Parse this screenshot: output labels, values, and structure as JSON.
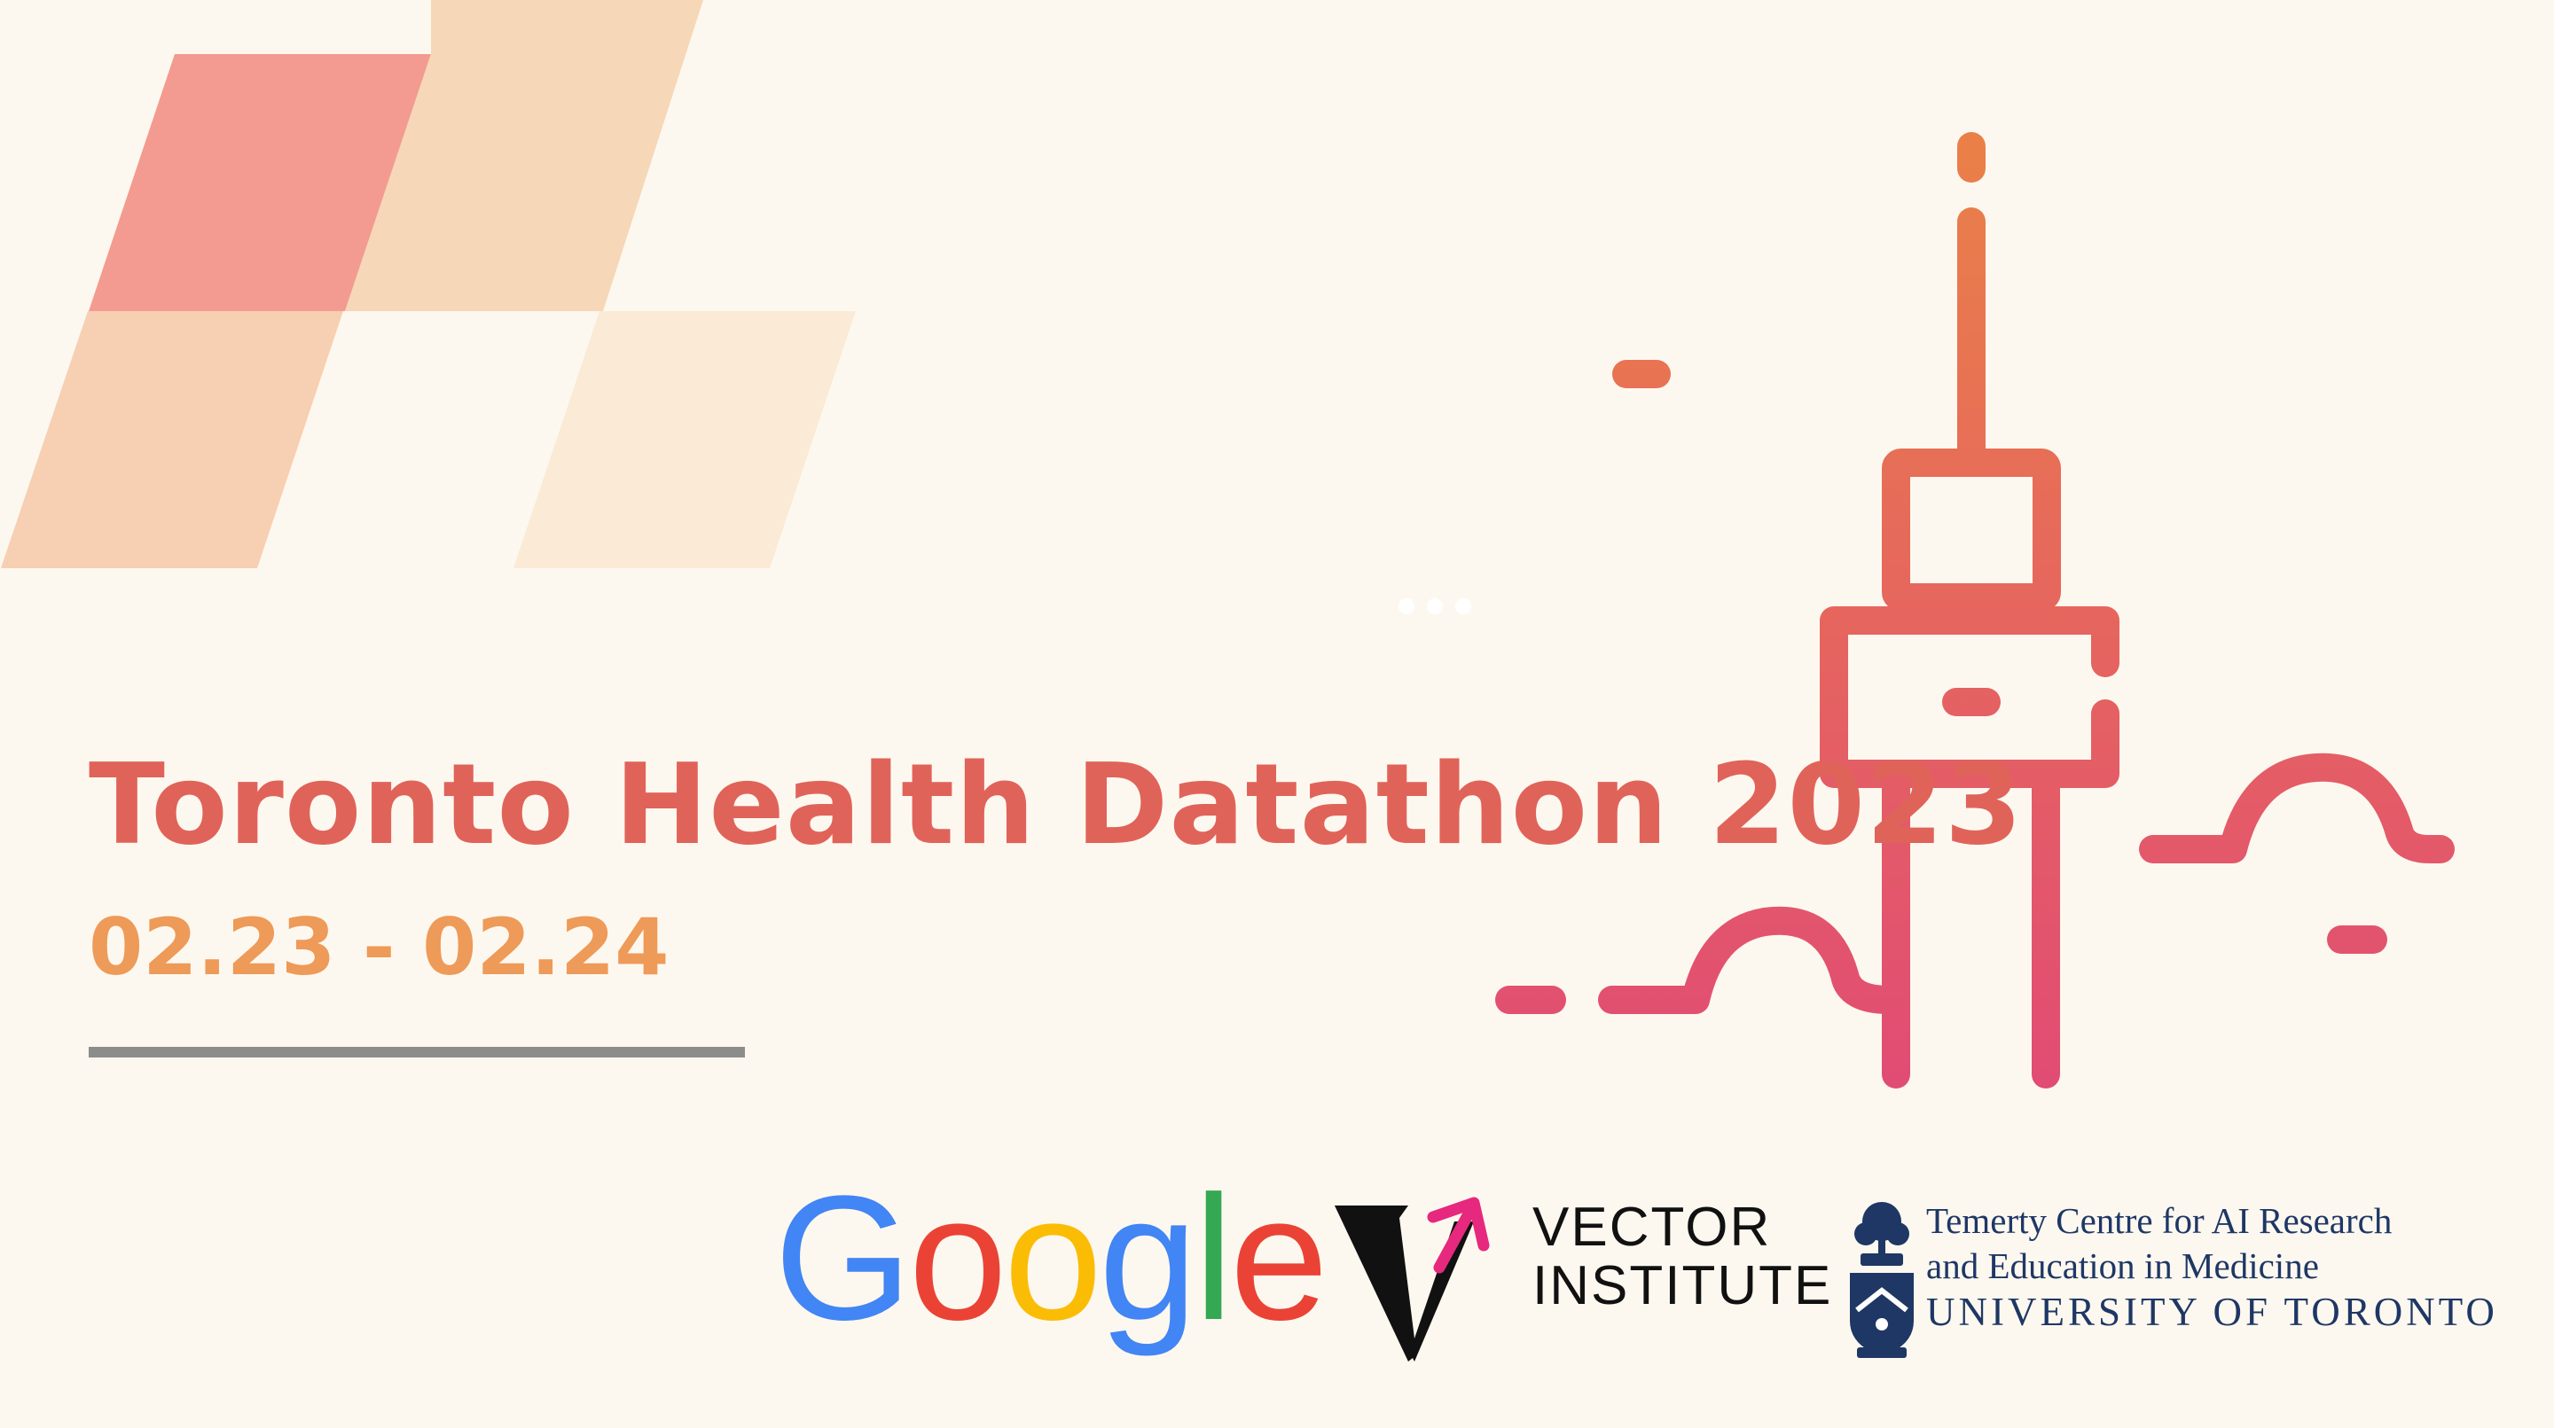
{
  "slide": {
    "title": "Toronto Health Datathon 2023",
    "dates": "02.23 - 02.24"
  },
  "sponsors": {
    "google": {
      "letters": [
        {
          "char": "G",
          "color": "#4285F4"
        },
        {
          "char": "o",
          "color": "#EA4335"
        },
        {
          "char": "o",
          "color": "#FBBC05"
        },
        {
          "char": "g",
          "color": "#4285F4"
        },
        {
          "char": "l",
          "color": "#34A853"
        },
        {
          "char": "e",
          "color": "#EA4335"
        }
      ]
    },
    "vector": {
      "line1": "VECTOR",
      "line2": "INSTITUTE",
      "logo_icon": "vector-v-arrow-icon"
    },
    "uoft": {
      "line1": "Temerty Centre for AI Research",
      "line2": "and Education in Medicine",
      "line3": "UNIVERSITY OF TORONTO",
      "crest_icon": "uoft-crest-icon"
    }
  },
  "colors": {
    "background": "#fdf8ef",
    "title": "#e0635a",
    "dates": "#ee9a58",
    "rule": "#8c8c8c",
    "tile_coral": "#f39b90",
    "tile_peach": "#f6d7b7",
    "tile_light_peach": "#f7cfb2",
    "tile_cream": "#faead6",
    "gradient_top": "#ea8048",
    "gradient_bottom": "#e14c74",
    "uoft_navy": "#1e3765"
  },
  "decor": {
    "tower_icon": "cn-tower-icon",
    "cloud_icon": "cloud-line-icon",
    "tiles_icon": "parallelogram-tiles-icon"
  }
}
